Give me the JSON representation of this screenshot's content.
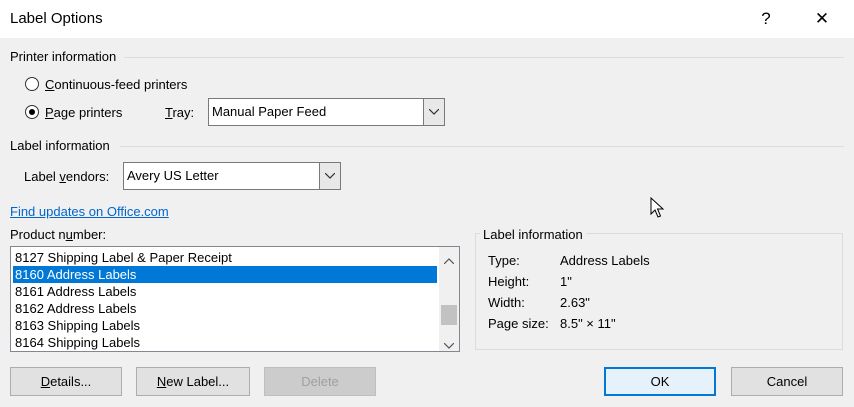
{
  "window": {
    "title": "Label Options",
    "help_glyph": "?",
    "close_glyph": "✕"
  },
  "printer": {
    "section_label": "Printer information",
    "continuous_label_first": "C",
    "continuous_label_rest": "ontinuous-feed printers",
    "page_label_first": "P",
    "page_label_rest": "age printers",
    "selected": "page",
    "tray_label_first": "T",
    "tray_label_rest": "ray:",
    "tray_value": "Manual Paper Feed"
  },
  "label_info": {
    "section_label": "Label information",
    "vendors_label_pre": "Label ",
    "vendors_label_mn": "v",
    "vendors_label_post": "endors:",
    "vendor_value": "Avery US Letter",
    "find_updates_link": "Find updates on Office.com",
    "product_label_pre": "Product n",
    "product_label_mn": "u",
    "product_label_post": "mber:",
    "products": [
      {
        "label": "8127 Shipping Label & Paper Receipt",
        "selected": false
      },
      {
        "label": "8160 Address Labels",
        "selected": true
      },
      {
        "label": "8161 Address Labels",
        "selected": false
      },
      {
        "label": "8162 Address Labels",
        "selected": false
      },
      {
        "label": "8163 Shipping Labels",
        "selected": false
      },
      {
        "label": "8164 Shipping Labels",
        "selected": false
      }
    ]
  },
  "details_panel": {
    "title": "Label information",
    "rows": [
      {
        "key": "Type:",
        "value": "Address Labels"
      },
      {
        "key": "Height:",
        "value": "1\""
      },
      {
        "key": "Width:",
        "value": "2.63\""
      },
      {
        "key": "Page size:",
        "value": "8.5\" × 11\""
      }
    ]
  },
  "buttons": {
    "details_mn": "D",
    "details_rest": "etails...",
    "new_label_mn": "N",
    "new_label_rest": "ew Label...",
    "delete": "Delete",
    "ok": "OK",
    "cancel": "Cancel"
  },
  "colors": {
    "accent": "#0078d7",
    "link": "#0066cc"
  }
}
